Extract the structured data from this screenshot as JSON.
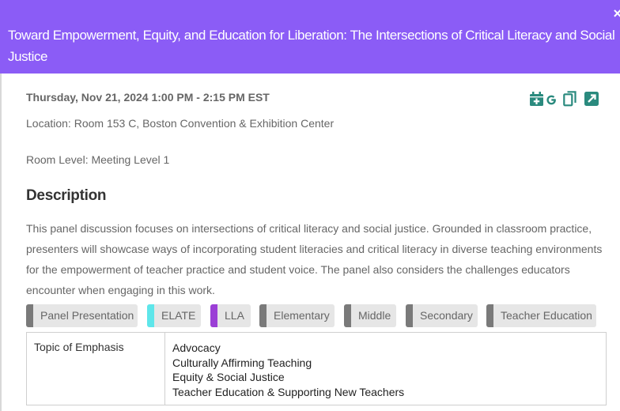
{
  "header": {
    "title": "Toward Empowerment, Equity, and Education for Liberation: The Intersections of Critical Literacy and Social Justice",
    "close_symbol": "×",
    "background": "#8b5cf6"
  },
  "session": {
    "datetime": "Thursday, Nov 21, 2024 1:00 PM - 2:15 PM EST",
    "location": "Location: Room 153 C, Boston Convention & Exhibition Center",
    "room_level": "Room Level: Meeting Level 1"
  },
  "actions": {
    "icons": [
      "calendar-add-icon",
      "google-icon",
      "copy-icon",
      "open-external-icon"
    ],
    "icon_color": "#2a8a7e"
  },
  "description": {
    "heading": "Description",
    "text": "This panel discussion focuses on intersections of critical literacy and social justice. Grounded in classroom practice, presenters will showcase ways of incorporating student literacies and critical literacy in diverse teaching environments for the empowerment of teacher practice and student voice. The panel also considers the challenges educators encounter when engaging in this work."
  },
  "tags": [
    {
      "label": "Panel Presentation",
      "color": "#7a7a7a"
    },
    {
      "label": "ELATE",
      "color": "#5ee6ea"
    },
    {
      "label": "LLA",
      "color": "#9b3fd6"
    },
    {
      "label": "Elementary",
      "color": "#7a7a7a"
    },
    {
      "label": "Middle",
      "color": "#7a7a7a"
    },
    {
      "label": "Secondary",
      "color": "#7a7a7a"
    },
    {
      "label": "Teacher Education",
      "color": "#7a7a7a"
    }
  ],
  "emphasis": {
    "label": "Topic of Emphasis",
    "items": [
      "Advocacy",
      "Culturally Affirming Teaching",
      "Equity & Social Justice",
      "Teacher Education & Supporting New Teachers"
    ]
  }
}
